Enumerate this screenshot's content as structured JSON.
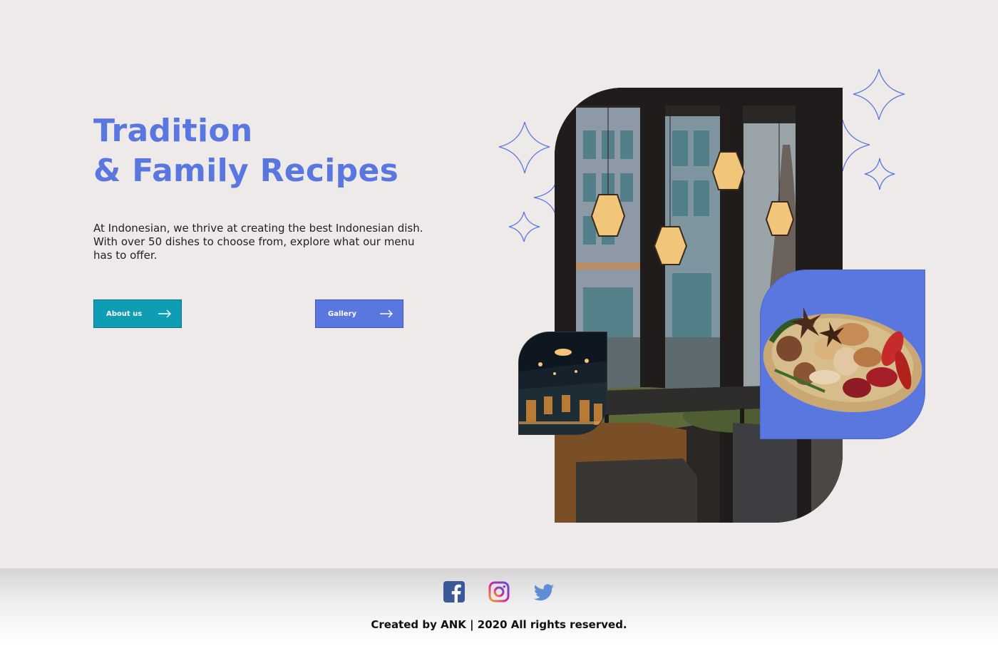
{
  "hero": {
    "title_line1": "Tradition",
    "title_line2": "& Family Recipes",
    "description": "At Indonesian, we thrive at creating the best Indonesian dish. With over 50 dishes to choose from, explore what our menu has to offer."
  },
  "buttons": {
    "about_label": "About us",
    "gallery_label": "Gallery"
  },
  "footer": {
    "social": [
      "facebook-icon",
      "instagram-icon",
      "twitter-icon"
    ],
    "copyright": "Created by ANK | 2020 All rights reserved."
  },
  "colors": {
    "accent_blue": "#5a77df",
    "accent_teal": "#0f9cb5",
    "background": "#eeeaea",
    "facebook": "#3b5998",
    "twitter": "#5d8ed6"
  }
}
